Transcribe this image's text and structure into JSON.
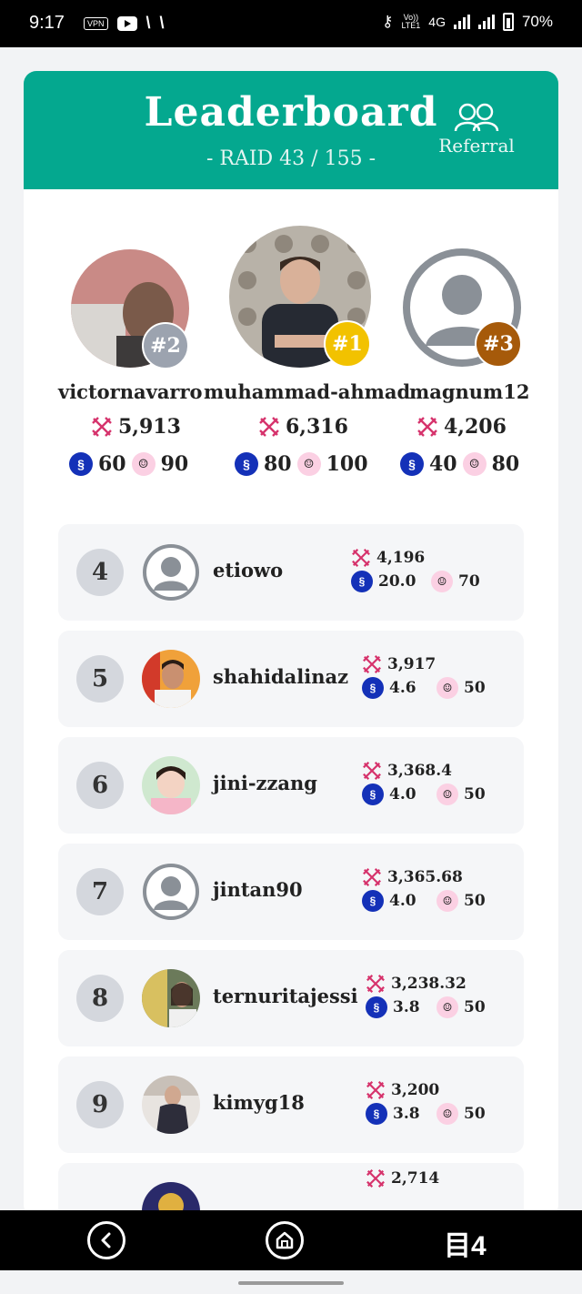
{
  "status_bar": {
    "time": "9:17",
    "vpn": "VPN",
    "network_top": "Vo))",
    "network_bottom": "LTE1",
    "network_type": "4G",
    "battery": "70%"
  },
  "header": {
    "title": "Leaderboard",
    "subtitle": "- RAID 43 / 155 -",
    "referral_label": "Referral"
  },
  "podium": [
    {
      "rank_label": "#2",
      "name": "victornavarro",
      "score": "5,913",
      "steem": "60",
      "chibi": "90",
      "badge_color": "#9ca3af"
    },
    {
      "rank_label": "#1",
      "name": "muhammad-ahmad",
      "score": "6,316",
      "steem": "80",
      "chibi": "100",
      "badge_color": "#f2c200"
    },
    {
      "rank_label": "#3",
      "name": "magnum12",
      "score": "4,206",
      "steem": "40",
      "chibi": "80",
      "badge_color": "#a65a0a"
    }
  ],
  "rows": [
    {
      "rank": "4",
      "name": "etiowo",
      "score": "4,196",
      "steem": "20.0",
      "chibi": "70"
    },
    {
      "rank": "5",
      "name": "shahidalinaz",
      "score": "3,917",
      "steem": "4.6",
      "chibi": "50"
    },
    {
      "rank": "6",
      "name": "jini-zzang",
      "score": "3,368.4",
      "steem": "4.0",
      "chibi": "50"
    },
    {
      "rank": "7",
      "name": "jintan90",
      "score": "3,365.68",
      "steem": "4.0",
      "chibi": "50"
    },
    {
      "rank": "8",
      "name": "ternuritajessi",
      "score": "3,238.32",
      "steem": "3.8",
      "chibi": "50"
    },
    {
      "rank": "9",
      "name": "kimyg18",
      "score": "3,200",
      "steem": "3.8",
      "chibi": "50"
    },
    {
      "rank": "",
      "name": "",
      "score": "2,714",
      "steem": "",
      "chibi": ""
    }
  ],
  "nav": {
    "brand": "目4"
  },
  "colors": {
    "header": "#04a88f",
    "steem": "#1431b8",
    "sword": "#d6336c"
  }
}
